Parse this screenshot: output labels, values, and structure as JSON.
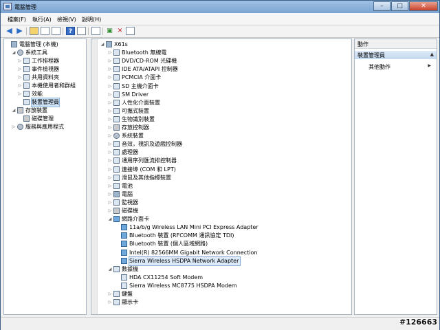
{
  "window": {
    "title": "電腦管理"
  },
  "menu": [
    "檔案(F)",
    "執行(A)",
    "檢視(V)",
    "說明(H)"
  ],
  "left_tree": [
    {
      "label": "電腦管理 (本機)",
      "level": 0,
      "twisty": "",
      "icon": "pc"
    },
    {
      "label": "系統工具",
      "level": 1,
      "twisty": "◢",
      "icon": "tools"
    },
    {
      "label": "工作排程器",
      "level": 2,
      "twisty": "▷",
      "icon": "clock"
    },
    {
      "label": "事件檢視器",
      "level": 2,
      "twisty": "▷",
      "icon": "log"
    },
    {
      "label": "共用資料夾",
      "level": 2,
      "twisty": "▷",
      "icon": "folder"
    },
    {
      "label": "本機使用者和群組",
      "level": 2,
      "twisty": "▷",
      "icon": "users"
    },
    {
      "label": "效能",
      "level": 2,
      "twisty": "▷",
      "icon": "perf"
    },
    {
      "label": "裝置管理員",
      "level": 2,
      "twisty": "",
      "icon": "device",
      "selected": true
    },
    {
      "label": "存放裝置",
      "level": 1,
      "twisty": "◢",
      "icon": "storage"
    },
    {
      "label": "磁碟管理",
      "level": 2,
      "twisty": "",
      "icon": "disk"
    },
    {
      "label": "服務與應用程式",
      "level": 1,
      "twisty": "▷",
      "icon": "services"
    }
  ],
  "device_tree": [
    {
      "label": "X61s",
      "level": 0,
      "twisty": "◢",
      "icon": "pc"
    },
    {
      "label": "Bluetooth 無線電",
      "level": 1,
      "twisty": "▷",
      "icon": "bluetooth"
    },
    {
      "label": "DVD/CD-ROM 光碟機",
      "level": 1,
      "twisty": "▷",
      "icon": "dvd"
    },
    {
      "label": "IDE ATA/ATAPI 控制器",
      "level": 1,
      "twisty": "▷",
      "icon": "ide"
    },
    {
      "label": "PCMCIA 介面卡",
      "level": 1,
      "twisty": "▷",
      "icon": "pcmcia"
    },
    {
      "label": "SD 主機介面卡",
      "level": 1,
      "twisty": "▷",
      "icon": "sd"
    },
    {
      "label": "SM Driver",
      "level": 1,
      "twisty": "▷",
      "icon": "driver"
    },
    {
      "label": "人性化介面裝置",
      "level": 1,
      "twisty": "▷",
      "icon": "hid"
    },
    {
      "label": "可攜式裝置",
      "level": 1,
      "twisty": "▷",
      "icon": "portable"
    },
    {
      "label": "生物識別裝置",
      "level": 1,
      "twisty": "▷",
      "icon": "biometric"
    },
    {
      "label": "存放控制器",
      "level": 1,
      "twisty": "▷",
      "icon": "storage"
    },
    {
      "label": "系統裝置",
      "level": 1,
      "twisty": "▷",
      "icon": "system"
    },
    {
      "label": "音效，視訊及遊戲控制器",
      "level": 1,
      "twisty": "▷",
      "icon": "sound"
    },
    {
      "label": "處理器",
      "level": 1,
      "twisty": "▷",
      "icon": "cpu"
    },
    {
      "label": "通用序列匯流排控制器",
      "level": 1,
      "twisty": "▷",
      "icon": "usb"
    },
    {
      "label": "連接埠 (COM 和 LPT)",
      "level": 1,
      "twisty": "▷",
      "icon": "port"
    },
    {
      "label": "滑鼠及其他指標裝置",
      "level": 1,
      "twisty": "▷",
      "icon": "mouse"
    },
    {
      "label": "電池",
      "level": 1,
      "twisty": "▷",
      "icon": "battery"
    },
    {
      "label": "電腦",
      "level": 1,
      "twisty": "▷",
      "icon": "computer"
    },
    {
      "label": "監視器",
      "level": 1,
      "twisty": "▷",
      "icon": "monitor"
    },
    {
      "label": "磁碟機",
      "level": 1,
      "twisty": "▷",
      "icon": "disk"
    },
    {
      "label": "網路介面卡",
      "level": 1,
      "twisty": "◢",
      "icon": "net"
    },
    {
      "label": "11a/b/g Wireless LAN Mini PCI Express Adapter",
      "level": 2,
      "twisty": "",
      "icon": "net"
    },
    {
      "label": "Bluetooth 裝置 (RFCOMM 通訊協定 TDI)",
      "level": 2,
      "twisty": "",
      "icon": "net"
    },
    {
      "label": "Bluetooth 裝置 (個人區域網路)",
      "level": 2,
      "twisty": "",
      "icon": "net"
    },
    {
      "label": "Intel(R) 82566MM Gigabit Network Connection",
      "level": 2,
      "twisty": "",
      "icon": "net"
    },
    {
      "label": "Sierra Wireless HSDPA Network Adapter",
      "level": 2,
      "twisty": "",
      "icon": "net",
      "selected": true
    },
    {
      "label": "數據機",
      "level": 1,
      "twisty": "◢",
      "icon": "modem"
    },
    {
      "label": "HDA CX11254 Soft Modem",
      "level": 2,
      "twisty": "",
      "icon": "modem"
    },
    {
      "label": "Sierra Wireless MC8775 HSDPA Modem",
      "level": 2,
      "twisty": "",
      "icon": "modem"
    },
    {
      "label": "鍵盤",
      "level": 1,
      "twisty": "▷",
      "icon": "keyboard"
    },
    {
      "label": "顯示卡",
      "level": 1,
      "twisty": "▷",
      "icon": "display"
    }
  ],
  "actions": {
    "header": "動作",
    "section": "裝置管理員",
    "more": "其他動作"
  },
  "watermark": "#126663"
}
